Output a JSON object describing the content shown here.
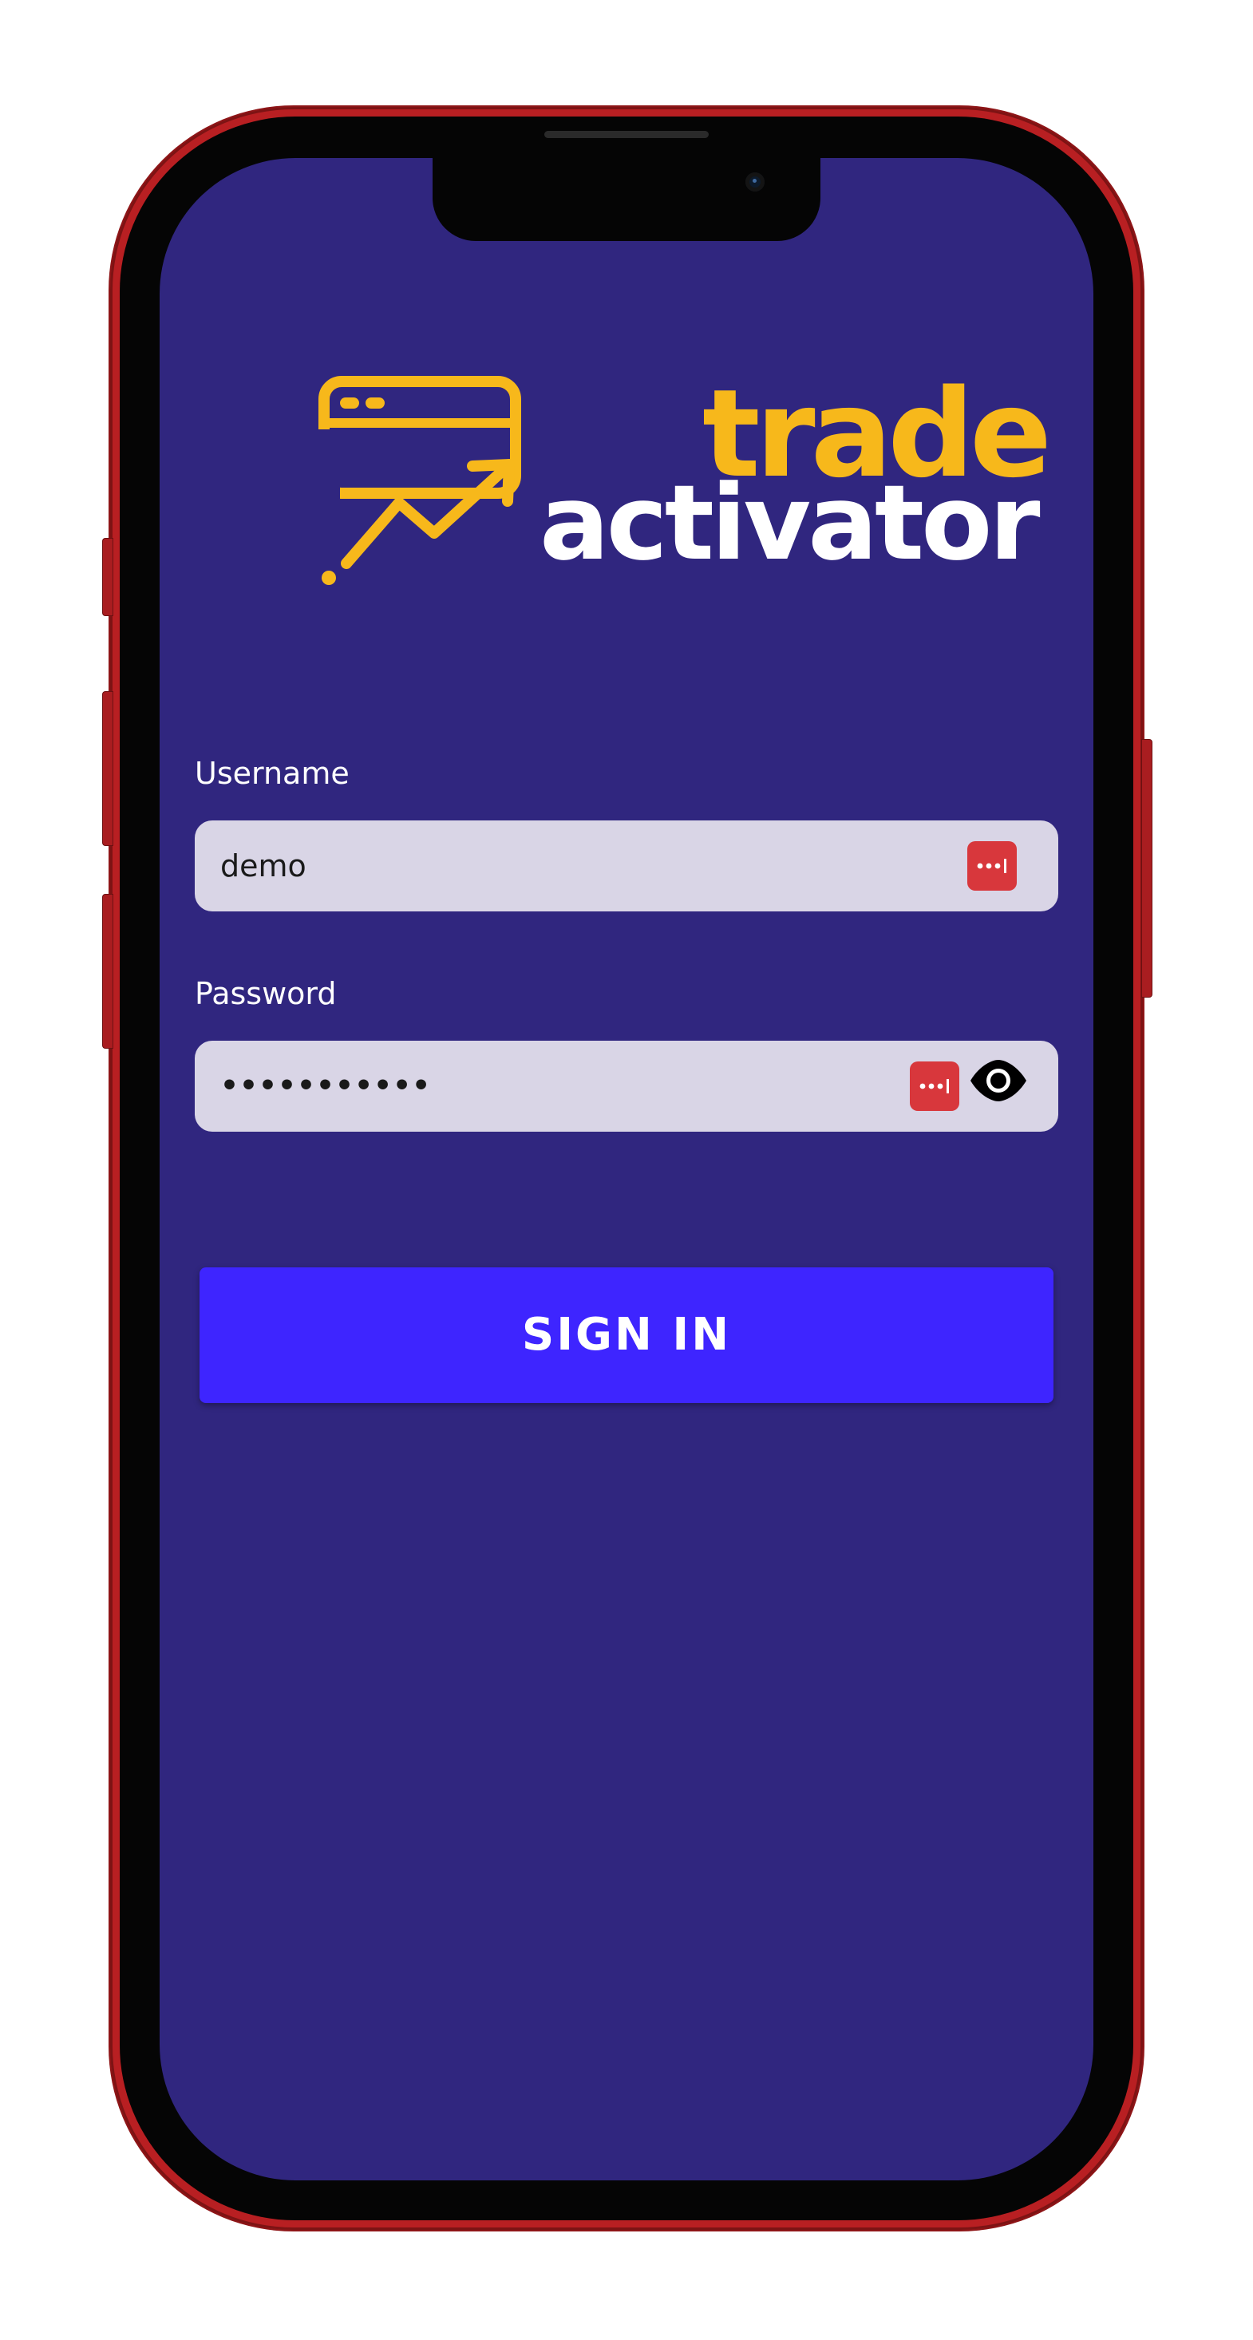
{
  "logo": {
    "word_top": "trade",
    "word_bottom": "activator",
    "color_top": "#f7b81b",
    "color_bottom": "#ffffff"
  },
  "form": {
    "username": {
      "label": "Username",
      "value": "demo"
    },
    "password": {
      "label": "Password",
      "value": "•••••••••••"
    },
    "submit_label": "SIGN IN"
  },
  "icons": {
    "password_manager": "password-manager-icon",
    "show_password": "eye-icon"
  },
  "colors": {
    "screen_bg": "#30267f",
    "input_bg": "#d9d5e6",
    "button_bg": "#3e25ff",
    "password_manager_red": "#d8373c",
    "phone_body": "#b81f22"
  }
}
